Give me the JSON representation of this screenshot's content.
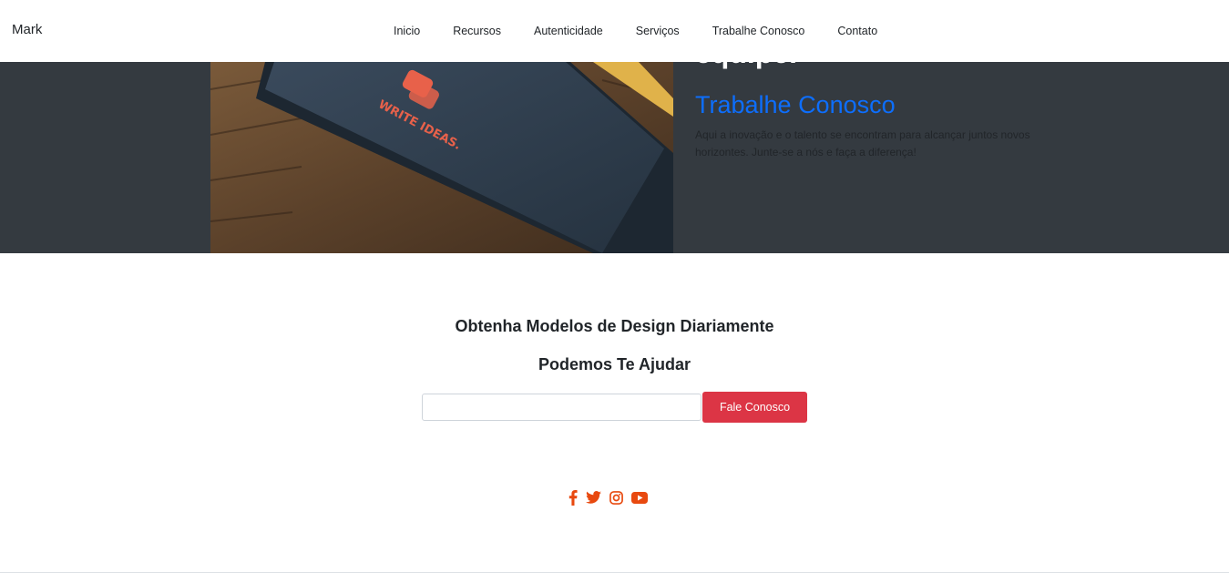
{
  "navbar": {
    "brand": "Mark",
    "links": [
      {
        "label": "Inicio"
      },
      {
        "label": "Recursos"
      },
      {
        "label": "Autenticidade"
      },
      {
        "label": "Serviços"
      },
      {
        "label": "Trabalhe Conosco"
      },
      {
        "label": "Contato"
      }
    ]
  },
  "hero": {
    "heading": "equipe.",
    "subheading": "Trabalhe Conosco",
    "description": "Aqui a inovação e o talento se encontram para alcançar juntos novos horizontes. Junte-se a nós e faça a diferença!",
    "image_text": "WRITE IDEAS.",
    "accent_color": "#0d6efd"
  },
  "cta": {
    "title": "Obtenha Modelos de Design Diariamente",
    "subtitle": "Podemos Te Ajudar",
    "input_value": "",
    "button_label": "Fale Conosco",
    "button_color": "#dc3545"
  },
  "social": {
    "color": "#e8490f",
    "icons": [
      "facebook-icon",
      "twitter-icon",
      "instagram-icon",
      "youtube-icon"
    ]
  }
}
